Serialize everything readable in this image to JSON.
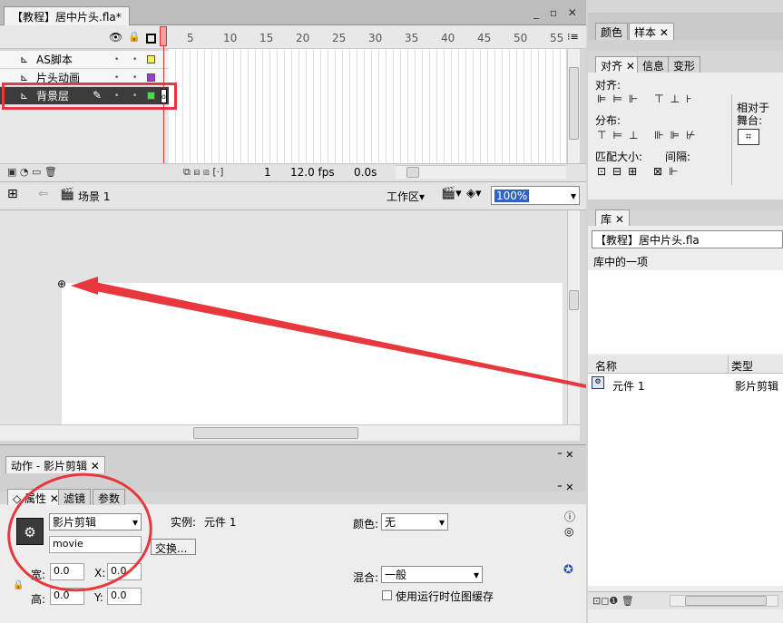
{
  "document_tab": {
    "title": "【教程】居中片头.fla*"
  },
  "window_controls": "_ ▫ ✕",
  "timeline": {
    "ruler": [
      "5",
      "10",
      "15",
      "20",
      "25",
      "30",
      "35",
      "40",
      "45",
      "50",
      "55"
    ],
    "layers": [
      {
        "name": "AS脚本",
        "color": "#f5f545"
      },
      {
        "name": "片头动画",
        "color": "#9b3bd1"
      },
      {
        "name": "背景层",
        "color": "#46e046"
      }
    ],
    "footer": {
      "frame": "1",
      "fps": "12.0 fps",
      "time": "0.0s"
    }
  },
  "edit_bar": {
    "scene": "场景 1",
    "workspace": "工作区",
    "zoom": "100%"
  },
  "actions_panel": {
    "tab": "动作 - 影片剪辑"
  },
  "properties_panel": {
    "tabs": [
      "属性",
      "滤镜",
      "参数"
    ],
    "symbol_type": "影片剪辑",
    "instance_label": "实例:",
    "instance_value": "元件 1",
    "instance_name": "movie",
    "swap_button": "交换...",
    "color_label": "颜色:",
    "color_value": "无",
    "blend_label": "混合:",
    "blend_value": "一般",
    "cache_label": "使用运行时位图缓存",
    "width_label": "宽:",
    "width_value": "0.0",
    "height_label": "高:",
    "height_value": "0.0",
    "x_label": "X:",
    "x_value": "0.0",
    "y_label": "Y:",
    "y_value": "0.0"
  },
  "color_panel": {
    "tabs": [
      "颜色",
      "样本"
    ]
  },
  "align_panel": {
    "tabs": [
      "对齐",
      "信息",
      "变形"
    ],
    "align_label": "对齐:",
    "distribute_label": "分布:",
    "match_size_label": "匹配大小:",
    "spacing_label": "间隔:",
    "relative_label_1": "相对于",
    "relative_label_2": "舞台:"
  },
  "library_panel": {
    "tab": "库",
    "document": "【教程】居中片头.fla",
    "count": "库中的一项",
    "col_name": "名称",
    "col_type": "类型",
    "items": [
      {
        "name": "元件 1",
        "type": "影片剪辑"
      }
    ]
  },
  "colors": {
    "accent_red": "#e8383d",
    "playhead": "#e03030",
    "selection": "#3c3c3c"
  }
}
